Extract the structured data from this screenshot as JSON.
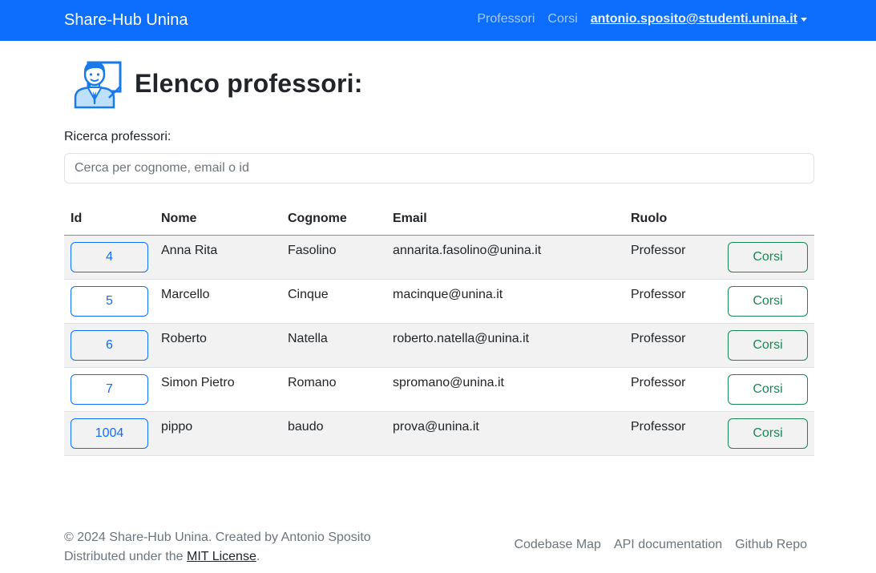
{
  "navbar": {
    "brand": "Share-Hub Unina",
    "links": [
      "Professori",
      "Corsi"
    ],
    "user_email": "antonio.sposito@studenti.unina.it"
  },
  "page": {
    "title": "Elenco professori:",
    "icon": "professor-icon"
  },
  "search": {
    "label": "Ricerca professori:",
    "placeholder": "Cerca per cognome, email o id",
    "value": ""
  },
  "table": {
    "headers": [
      "Id",
      "Nome",
      "Cognome",
      "Email",
      "Ruolo"
    ],
    "action_label": "Corsi",
    "rows": [
      {
        "id": "4",
        "nome": "Anna Rita",
        "cognome": "Fasolino",
        "email": "annarita.fasolino@unina.it",
        "ruolo": "Professor"
      },
      {
        "id": "5",
        "nome": "Marcello",
        "cognome": "Cinque",
        "email": "macinque@unina.it",
        "ruolo": "Professor"
      },
      {
        "id": "6",
        "nome": "Roberto",
        "cognome": "Natella",
        "email": "roberto.natella@unina.it",
        "ruolo": "Professor"
      },
      {
        "id": "7",
        "nome": "Simon Pietro",
        "cognome": "Romano",
        "email": "spromano@unina.it",
        "ruolo": "Professor"
      },
      {
        "id": "1004",
        "nome": "pippo",
        "cognome": "baudo",
        "email": "prova@unina.it",
        "ruolo": "Professor"
      }
    ]
  },
  "footer": {
    "copyright": "© 2024 Share-Hub Unina. Created by Antonio Sposito",
    "license_prefix": "Distributed under the",
    "license_link": "MIT License",
    "license_suffix": ".",
    "links": [
      "Codebase Map",
      "API documentation",
      "Github Repo"
    ]
  },
  "colors": {
    "primary": "#0d6efd",
    "success": "#198754",
    "stripe": "#f2f2f2"
  }
}
